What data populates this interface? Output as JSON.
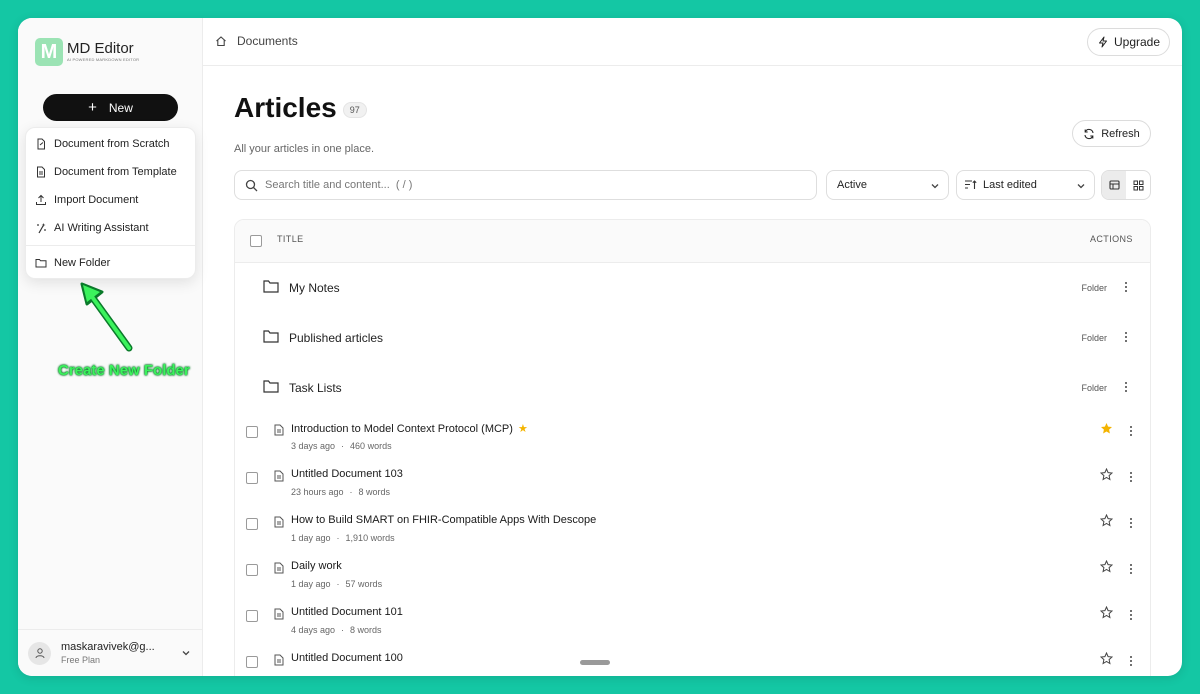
{
  "colors": {
    "background": "#14c7a4",
    "accent": "#111111",
    "logo": "#9be3b4",
    "annotation": "#3bf25c",
    "star": "#f4b400"
  },
  "app": {
    "logo_letter": "M",
    "name": "MD Editor",
    "tagline": "AI POWERED MARKDOWN EDITOR"
  },
  "sidebar": {
    "new_label": "New",
    "menu": [
      {
        "label": "Document from Scratch",
        "icon": "new-document-icon"
      },
      {
        "label": "Document from Template",
        "icon": "template-icon"
      },
      {
        "label": "Import Document",
        "icon": "import-icon"
      },
      {
        "label": "AI Writing Assistant",
        "icon": "sparkles-icon"
      },
      {
        "label": "New Folder",
        "icon": "folder-icon"
      }
    ],
    "user": {
      "email": "maskaravivek@g...",
      "plan": "Free Plan"
    }
  },
  "annotation": {
    "label": "Create New Folder"
  },
  "header": {
    "breadcrumb": "Documents",
    "upgrade_label": "Upgrade"
  },
  "main": {
    "title": "Articles",
    "count": "97",
    "subtitle": "All your articles in one place.",
    "refresh_label": "Refresh",
    "search_placeholder": "Search title and content...  ( / )",
    "status_filter": "Active",
    "sort": "Last edited"
  },
  "table": {
    "headers": {
      "title": "TITLE",
      "actions": "ACTIONS"
    },
    "folders": [
      {
        "name": "My Notes",
        "kind": "Folder"
      },
      {
        "name": "Published articles",
        "kind": "Folder"
      },
      {
        "name": "Task Lists",
        "kind": "Folder"
      }
    ],
    "documents": [
      {
        "title": "Introduction to Model Context Protocol (MCP)",
        "time": "3 days ago",
        "words": "460 words",
        "starred": true
      },
      {
        "title": "Untitled Document 103",
        "time": "23 hours ago",
        "words": "8 words",
        "starred": false
      },
      {
        "title": "How to Build SMART on FHIR-Compatible Apps With Descope",
        "time": "1 day ago",
        "words": "1,910 words",
        "starred": false
      },
      {
        "title": "Daily work",
        "time": "1 day ago",
        "words": "57 words",
        "starred": false
      },
      {
        "title": "Untitled Document 101",
        "time": "4 days ago",
        "words": "8 words",
        "starred": false
      },
      {
        "title": "Untitled Document 100",
        "time": "",
        "words": "",
        "starred": false
      }
    ]
  }
}
